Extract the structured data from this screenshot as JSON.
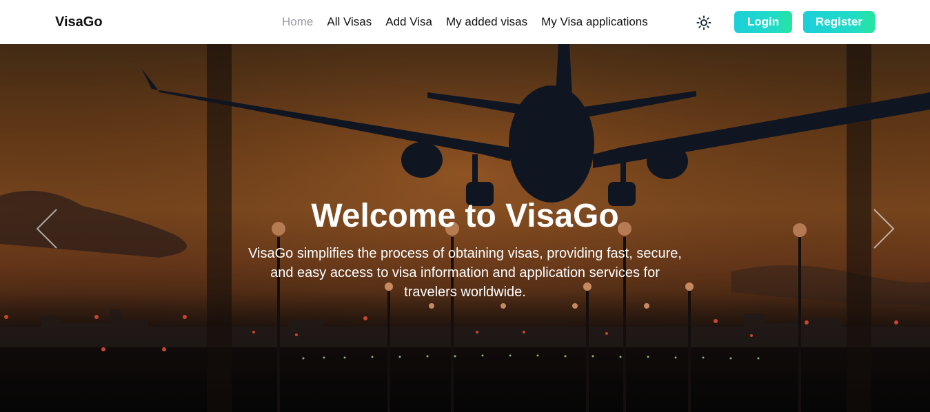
{
  "navbar": {
    "brand": "VisaGo",
    "links": [
      {
        "label": "Home",
        "active": true
      },
      {
        "label": "All Visas",
        "active": false
      },
      {
        "label": "Add Visa",
        "active": false
      },
      {
        "label": "My added visas",
        "active": false
      },
      {
        "label": "My Visa applications",
        "active": false
      }
    ],
    "theme_icon": "sun-icon",
    "login_label": "Login",
    "register_label": "Register"
  },
  "hero": {
    "title": "Welcome to VisaGo",
    "subtitle": "VisaGo simplifies the process of obtaining visas, providing fast, secure, and easy access to visa information and application services for travelers worldwide.",
    "prev_icon": "chevron-left-icon",
    "next_icon": "chevron-right-icon",
    "image_subject": "airplane-landing-at-sunset"
  },
  "colors": {
    "button_gradient_start": "#1ccfd8",
    "button_gradient_end": "#26e59b",
    "active_link": "#9a9aa5",
    "text_dark": "#111111"
  }
}
